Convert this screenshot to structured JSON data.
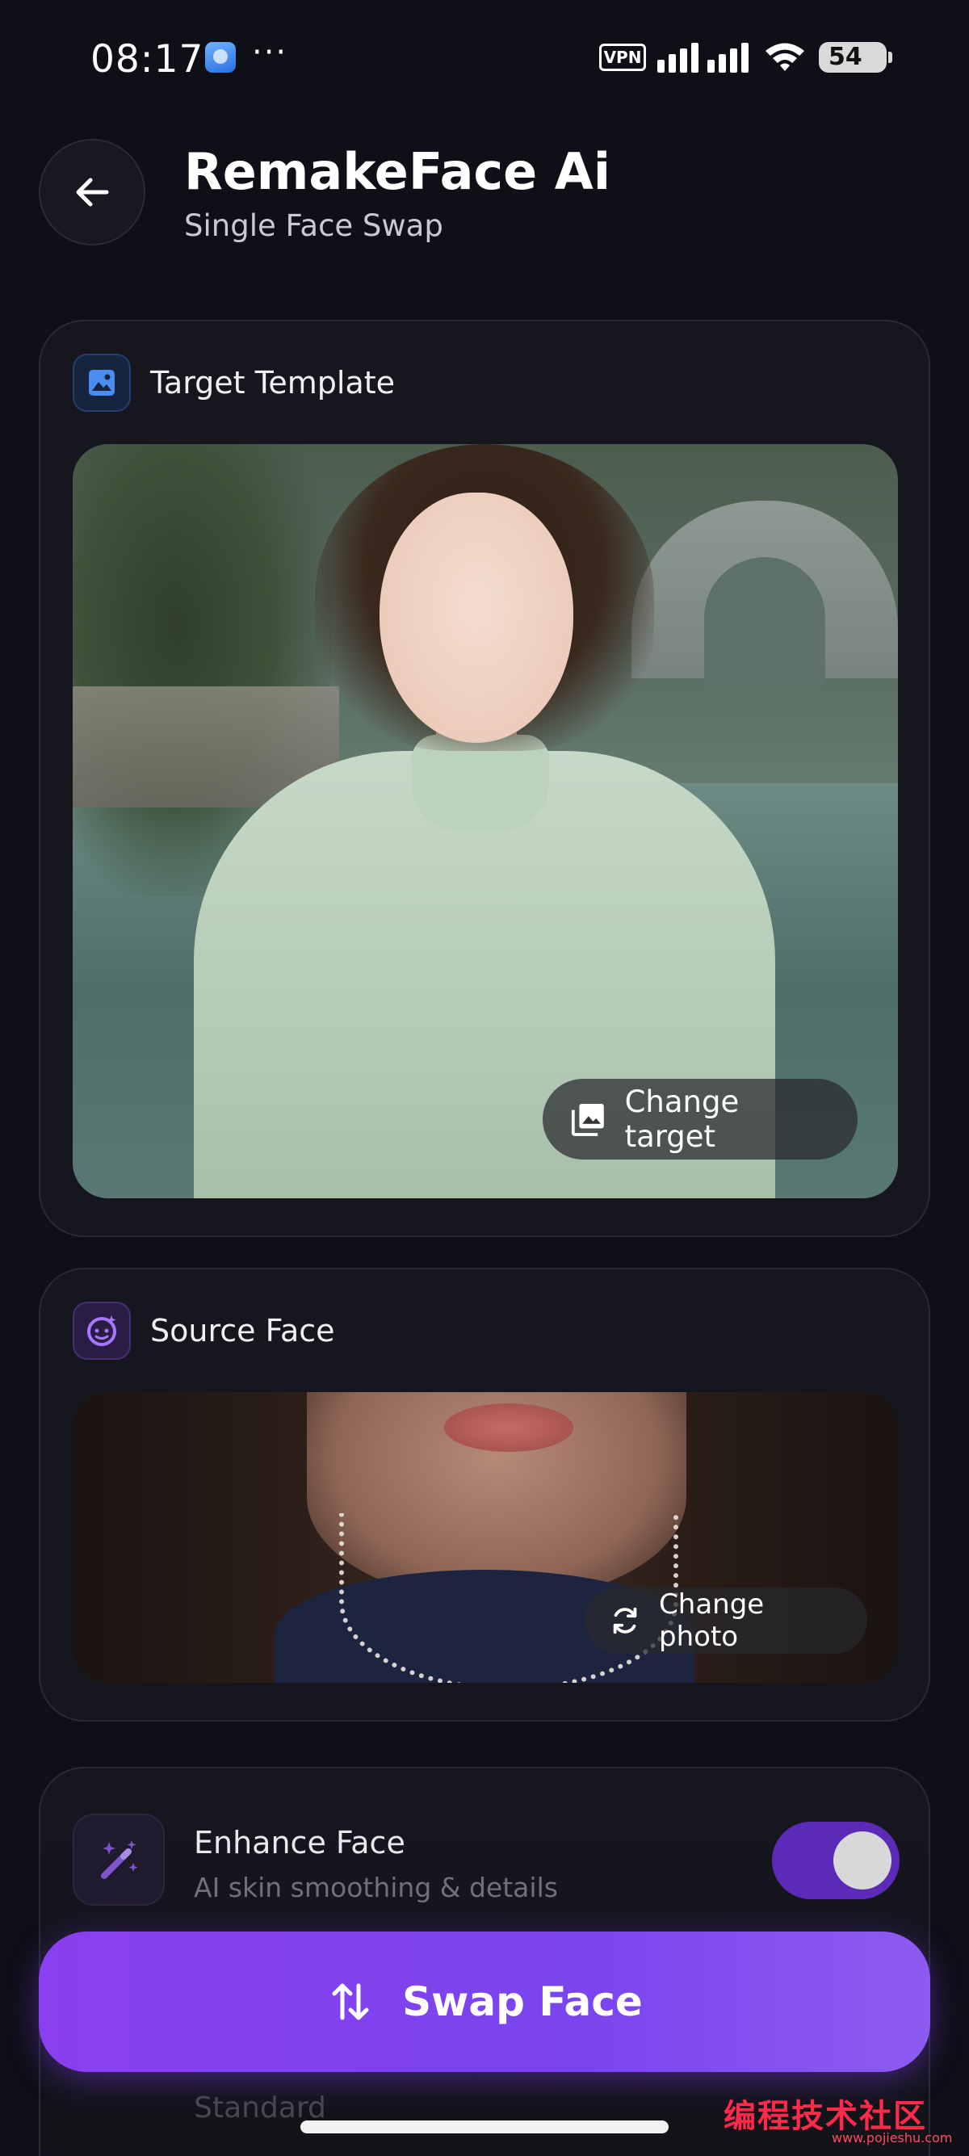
{
  "status_bar": {
    "time": "08:17",
    "dots": "···",
    "vpn": "VPN",
    "battery": "54"
  },
  "header": {
    "title": "RemakeFace Ai",
    "subtitle": "Single Face Swap"
  },
  "target_card": {
    "label": "Target Template",
    "change_button": "Change target"
  },
  "source_card": {
    "label": "Source Face",
    "change_button": "Change photo"
  },
  "enhance": {
    "title": "Enhance Face",
    "subtitle": "AI skin smoothing & details",
    "enabled": true
  },
  "bottom_tabs": [
    "Standard",
    ""
  ],
  "swap_button": {
    "label": "Swap Face"
  },
  "watermark": {
    "text": "编程技术社区",
    "url": "www.pojieshu.com"
  },
  "colors": {
    "background": "#0f0f17",
    "accent": "#7a44ee",
    "toggle_on": "#5b2bb8",
    "card": "#16161f"
  }
}
